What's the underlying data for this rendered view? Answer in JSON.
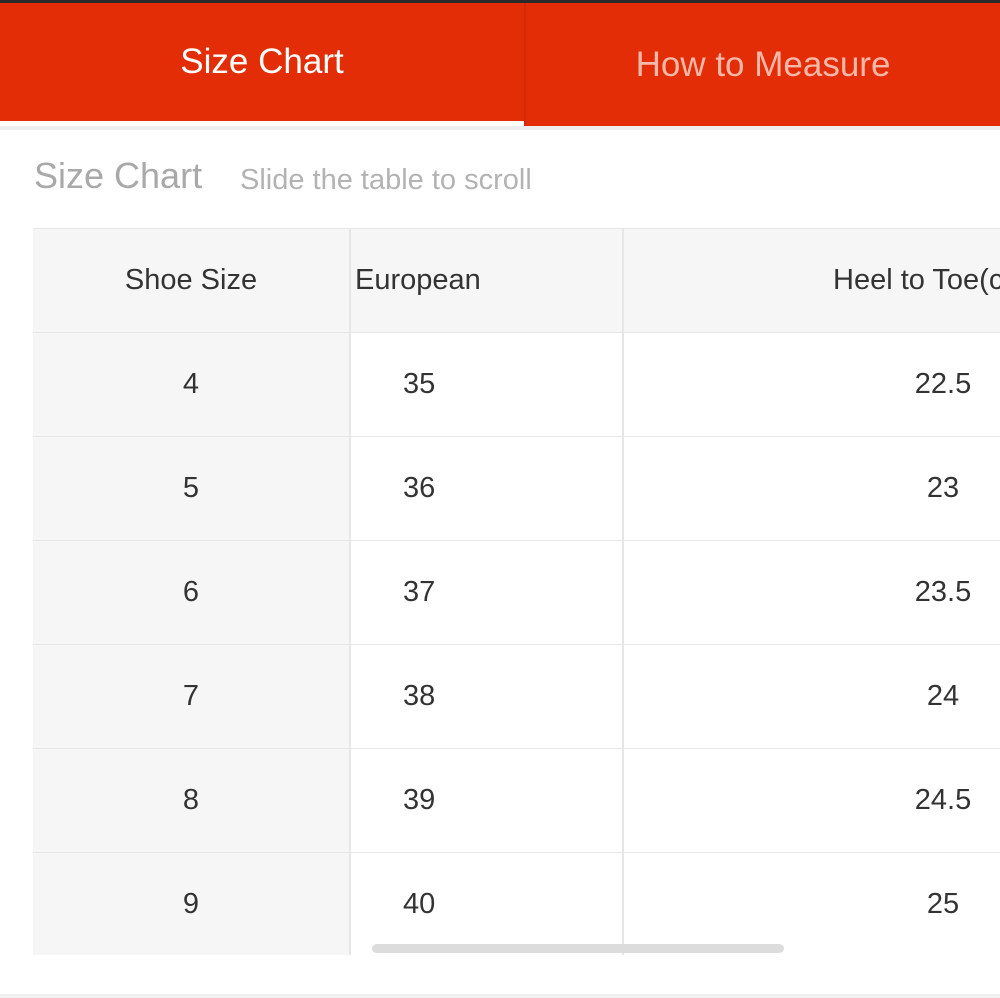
{
  "tabs": [
    {
      "label": "Size Chart",
      "active": true
    },
    {
      "label": "How to Measure",
      "active": false
    }
  ],
  "section": {
    "title": "Size Chart",
    "hint": "Slide the table to scroll"
  },
  "table": {
    "headers": [
      "Shoe Size",
      "European",
      "Heel to Toe(c"
    ],
    "rows": [
      [
        "4",
        "35",
        "22.5"
      ],
      [
        "5",
        "36",
        "23"
      ],
      [
        "6",
        "37",
        "23.5"
      ],
      [
        "7",
        "38",
        "24"
      ],
      [
        "8",
        "39",
        "24.5"
      ],
      [
        "9",
        "40",
        "25"
      ]
    ]
  },
  "colors": {
    "accent": "#e32d06",
    "active_tab_text": "#ffffff",
    "inactive_tab_text": "#f6b8a8"
  }
}
